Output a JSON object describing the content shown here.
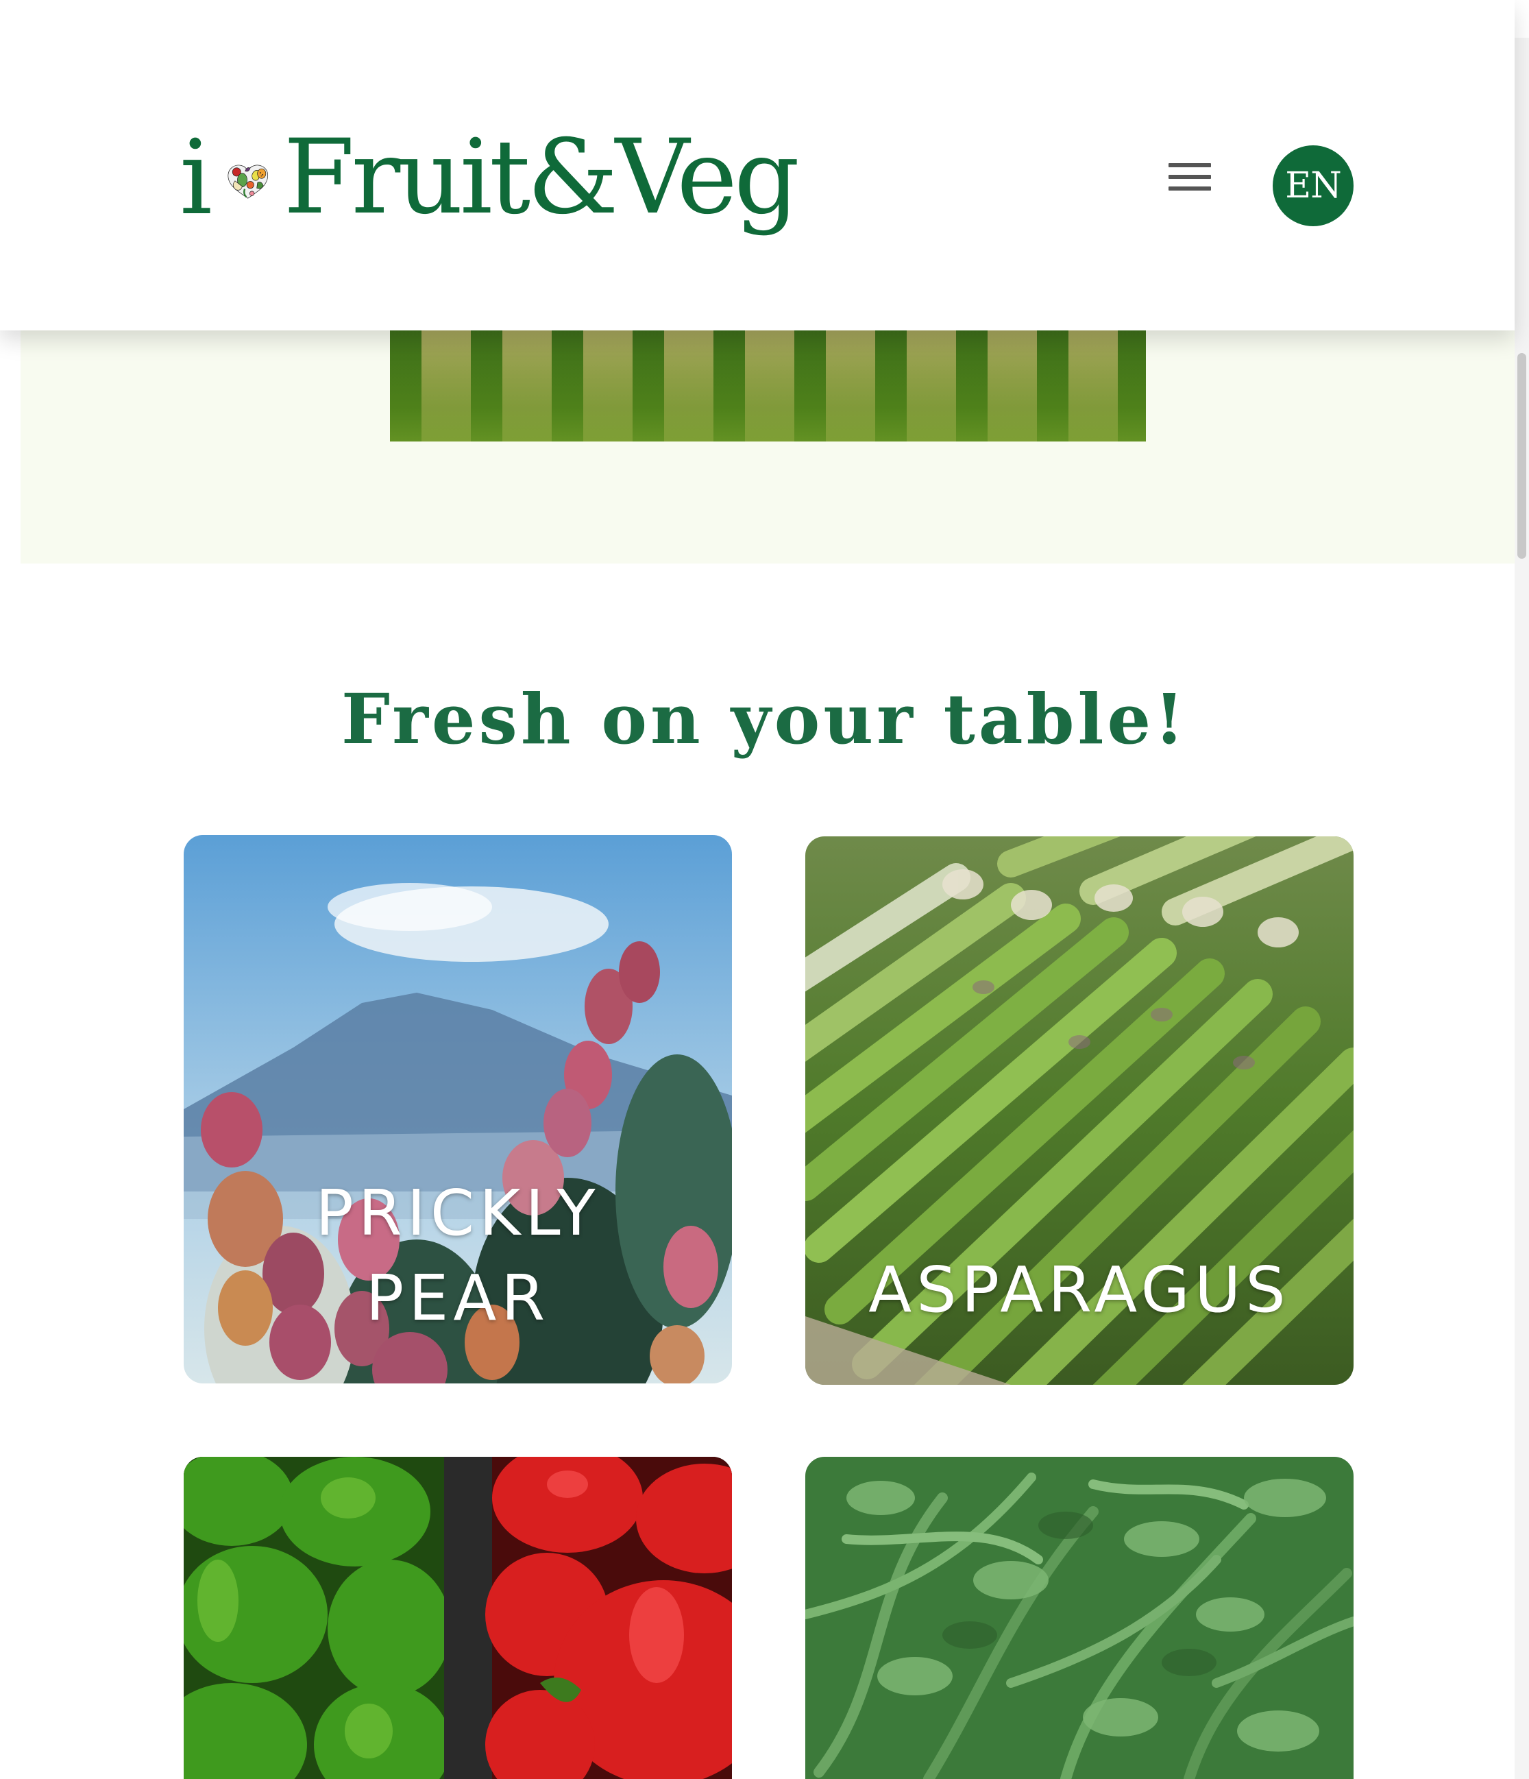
{
  "header": {
    "logo_i": "i",
    "logo_text": "Fruit&Veg",
    "language": "EN"
  },
  "section": {
    "title": "Fresh on your table!"
  },
  "products": [
    {
      "label_line1": "PRICKLY",
      "label_line2": "PEAR"
    },
    {
      "label": "ASPARAGUS"
    }
  ],
  "colors": {
    "brand_green": "#0f6a39",
    "title_green": "#1b6b43",
    "hero_background": "#f8fbf0"
  },
  "icons": {
    "menu": "hamburger-menu-icon",
    "logo": "heart-of-fruit-and-veg-logo"
  }
}
